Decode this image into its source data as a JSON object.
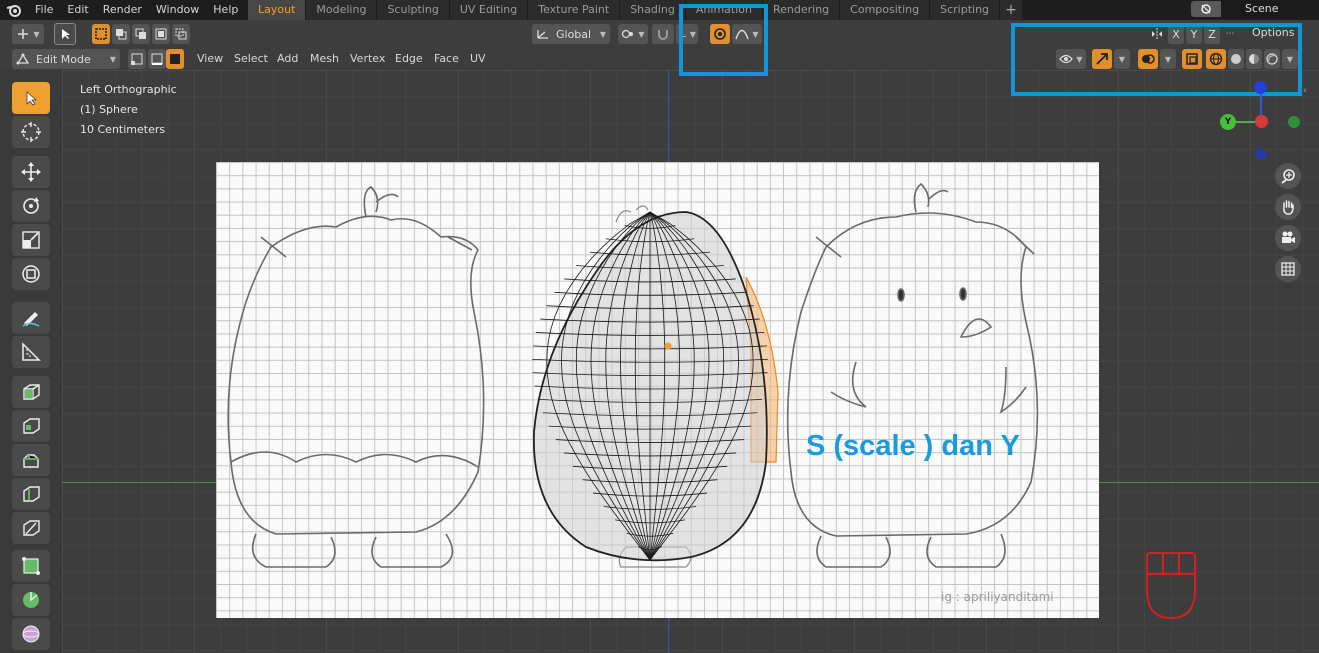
{
  "menubar": {
    "items": [
      "File",
      "Edit",
      "Render",
      "Window",
      "Help"
    ]
  },
  "workspace_tabs": [
    {
      "label": "Layout",
      "active": true
    },
    {
      "label": "Modeling"
    },
    {
      "label": "Sculpting"
    },
    {
      "label": "UV Editing"
    },
    {
      "label": "Texture Paint"
    },
    {
      "label": "Shading"
    },
    {
      "label": "Animation"
    },
    {
      "label": "Rendering"
    },
    {
      "label": "Compositing"
    },
    {
      "label": "Scripting"
    }
  ],
  "add_workspace": "+",
  "scene": {
    "name": "Scene"
  },
  "header": {
    "mode": "Edit Mode",
    "transform_orientation": "Global",
    "axis_x": "X",
    "axis_y": "Y",
    "axis_z": "Z",
    "options": "Options",
    "menus": [
      "View",
      "Select",
      "Add",
      "Mesh",
      "Vertex",
      "Edge",
      "Face",
      "UV"
    ]
  },
  "viewport": {
    "view_name": "Left Orthographic",
    "object": "(1) Sphere",
    "scale": "10 Centimeters"
  },
  "annotation": "S (scale ) dan Y",
  "watermark": "ig : apriliyanditami",
  "gizmo": {
    "y_label": "Y"
  },
  "colors": {
    "accent": "#e08f2a",
    "annotation_blue": "#1196d8",
    "active_tab_text": "#ff9a29"
  }
}
